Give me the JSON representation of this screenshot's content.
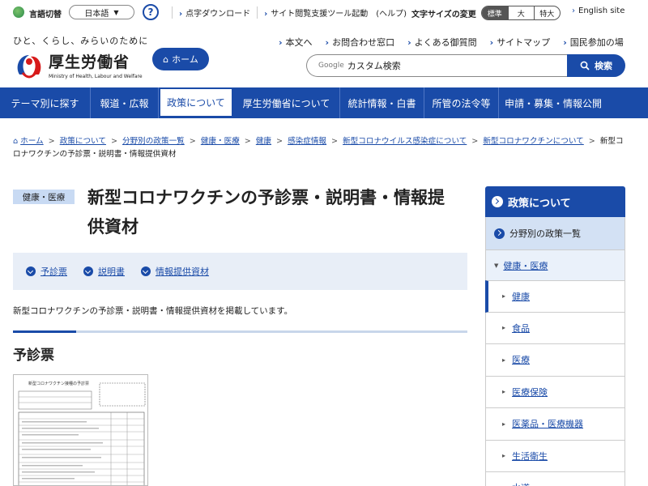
{
  "util": {
    "lang_label": "言語切替",
    "lang_value": "日本語",
    "help": "?",
    "links": [
      "点字ダウンロード",
      "サイト閲覧支援ツール起動",
      "(ヘルプ)"
    ],
    "fontsize_label": "文字サイズの変更",
    "fontsize_options": [
      "標準",
      "大",
      "特大"
    ],
    "english": "English site"
  },
  "header": {
    "tagline": "ひと、くらし、みらいのために",
    "logo_text": "厚生労働省",
    "logo_sub": "Ministry of Health, Labour and Welfare",
    "home": "ホーム",
    "links": [
      "本文へ",
      "お問合わせ窓口",
      "よくある御質問",
      "サイトマップ",
      "国民参加の場"
    ],
    "search_google": "Google",
    "search_placeholder": "カスタム検索",
    "search_button": "検索"
  },
  "nav": [
    "テーマ別に探す",
    "報道・広報",
    "政策について",
    "厚生労働省について",
    "統計情報・白書",
    "所管の法令等",
    "申請・募集・情報公開"
  ],
  "breadcrumb": [
    "ホーム",
    "政策について",
    "分野別の政策一覧",
    "健康・医療",
    "健康",
    "感染症情報",
    "新型コロナウイルス感染症について",
    "新型コロナワクチンについて"
  ],
  "breadcrumb_current": "新型コロナワクチンの予診票・説明書・情報提供資材",
  "content": {
    "category": "健康・医療",
    "title": "新型コロナワクチンの予診票・説明書・情報提供資材",
    "anchors": [
      "予診票",
      "説明書",
      "情報提供資材"
    ],
    "intro": "新型コロナワクチンの予診票・説明書・情報提供資材を掲載しています。",
    "section_title": "予診票",
    "thumb_title": "新型コロナワクチン接種の予診票"
  },
  "sidebar": {
    "head": "政策について",
    "sub": "分野別の政策一覧",
    "sub2": "健康・医療",
    "items": [
      "健康",
      "食品",
      "医療",
      "医療保険",
      "医薬品・医療機器",
      "生活衛生",
      "水道"
    ]
  }
}
